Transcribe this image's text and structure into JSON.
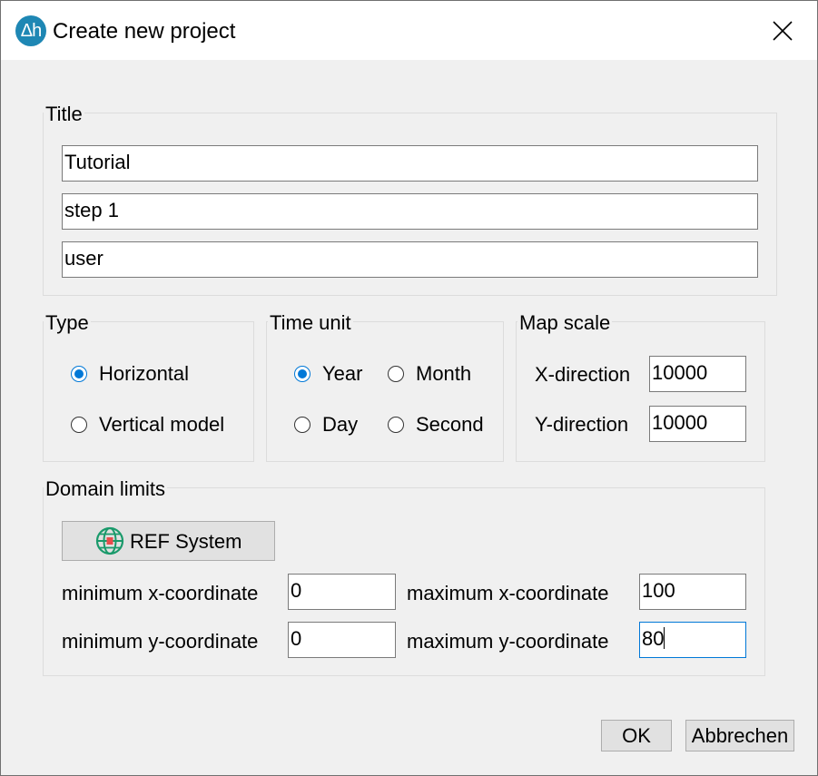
{
  "window": {
    "title": "Create new project",
    "app_icon_text": "Δh"
  },
  "title_group": {
    "legend": "Title",
    "fields": [
      "Tutorial",
      "step 1",
      "user"
    ]
  },
  "type_group": {
    "legend": "Type",
    "options": [
      {
        "label": "Horizontal",
        "checked": true
      },
      {
        "label": "Vertical model",
        "checked": false
      }
    ]
  },
  "time_unit_group": {
    "legend": "Time unit",
    "options": [
      {
        "label": "Year",
        "checked": true
      },
      {
        "label": "Month",
        "checked": false
      },
      {
        "label": "Day",
        "checked": false
      },
      {
        "label": "Second",
        "checked": false
      }
    ]
  },
  "map_scale_group": {
    "legend": "Map scale",
    "x_label": "X-direction",
    "x_value": "10000",
    "y_label": "Y-direction",
    "y_value": "10000"
  },
  "domain_group": {
    "legend": "Domain limits",
    "ref_button_label": "REF System",
    "min_x_label": "minimum x-coordinate",
    "min_x_value": "0",
    "max_x_label": "maximum x-coordinate",
    "max_x_value": "100",
    "min_y_label": "minimum y-coordinate",
    "min_y_value": "0",
    "max_y_label": "maximum y-coordinate",
    "max_y_value": "80"
  },
  "buttons": {
    "ok_label": "OK",
    "cancel_label": "Abbrechen"
  },
  "colors": {
    "accent": "#0078d7",
    "app_icon": "#1e87b4",
    "globe": "#1a9a6b"
  }
}
